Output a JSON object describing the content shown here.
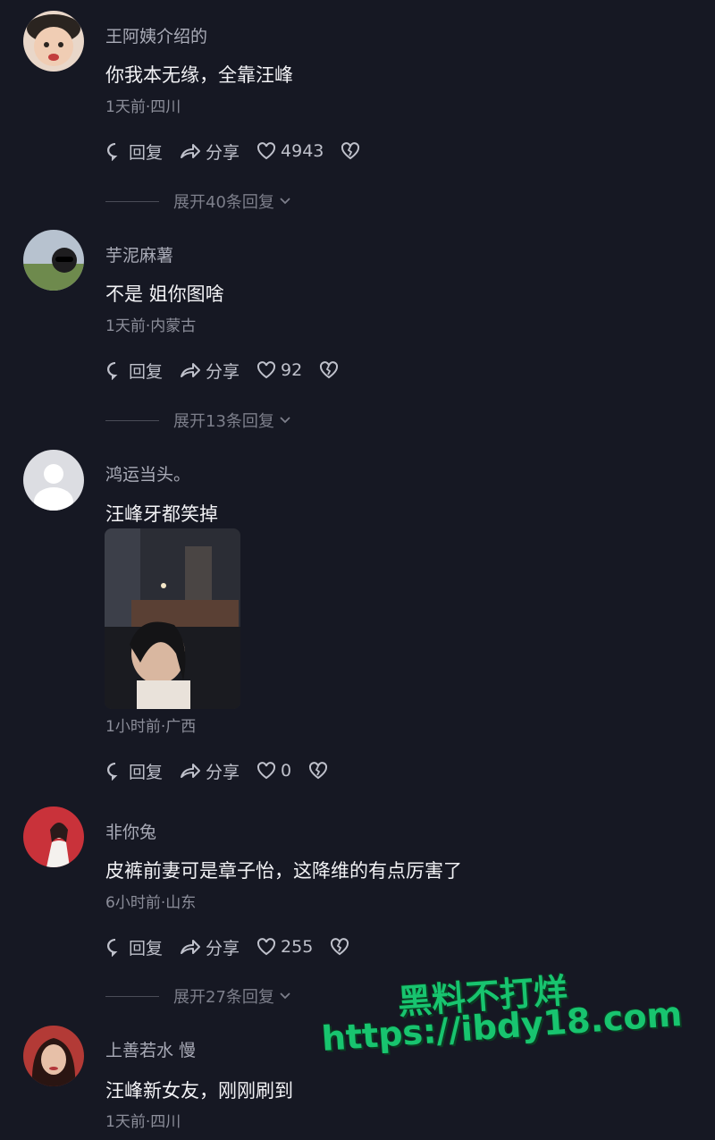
{
  "labels": {
    "reply": "回复",
    "share": "分享"
  },
  "comments": [
    {
      "username": "王阿姨介绍的",
      "text": "你我本无缘，全靠汪峰",
      "meta": "1天前·四川",
      "likes": "4943",
      "expand": "展开40条回复"
    },
    {
      "username": "芋泥麻薯",
      "text": "不是 姐你图啥",
      "meta": "1天前·内蒙古",
      "likes": "92",
      "expand": "展开13条回复"
    },
    {
      "username": "鸿运当头。",
      "text": "汪峰牙都笑掉",
      "meta": "1小时前·广西",
      "likes": "0",
      "expand": ""
    },
    {
      "username": "非你兔",
      "text": "皮裤前妻可是章子怡，这降维的有点厉害了",
      "meta": "6小时前·山东",
      "likes": "255",
      "expand": "展开27条回复"
    },
    {
      "username": "上善若水 慢",
      "text": "汪峰新女友，刚刚刷到",
      "meta": "1天前·四川",
      "likes": "",
      "expand": ""
    }
  ],
  "watermark": {
    "line1": "黑料不打烊",
    "line2": "https://ibdy18.com"
  },
  "colors": {
    "background": "#161823",
    "watermark": "#18c46f"
  }
}
